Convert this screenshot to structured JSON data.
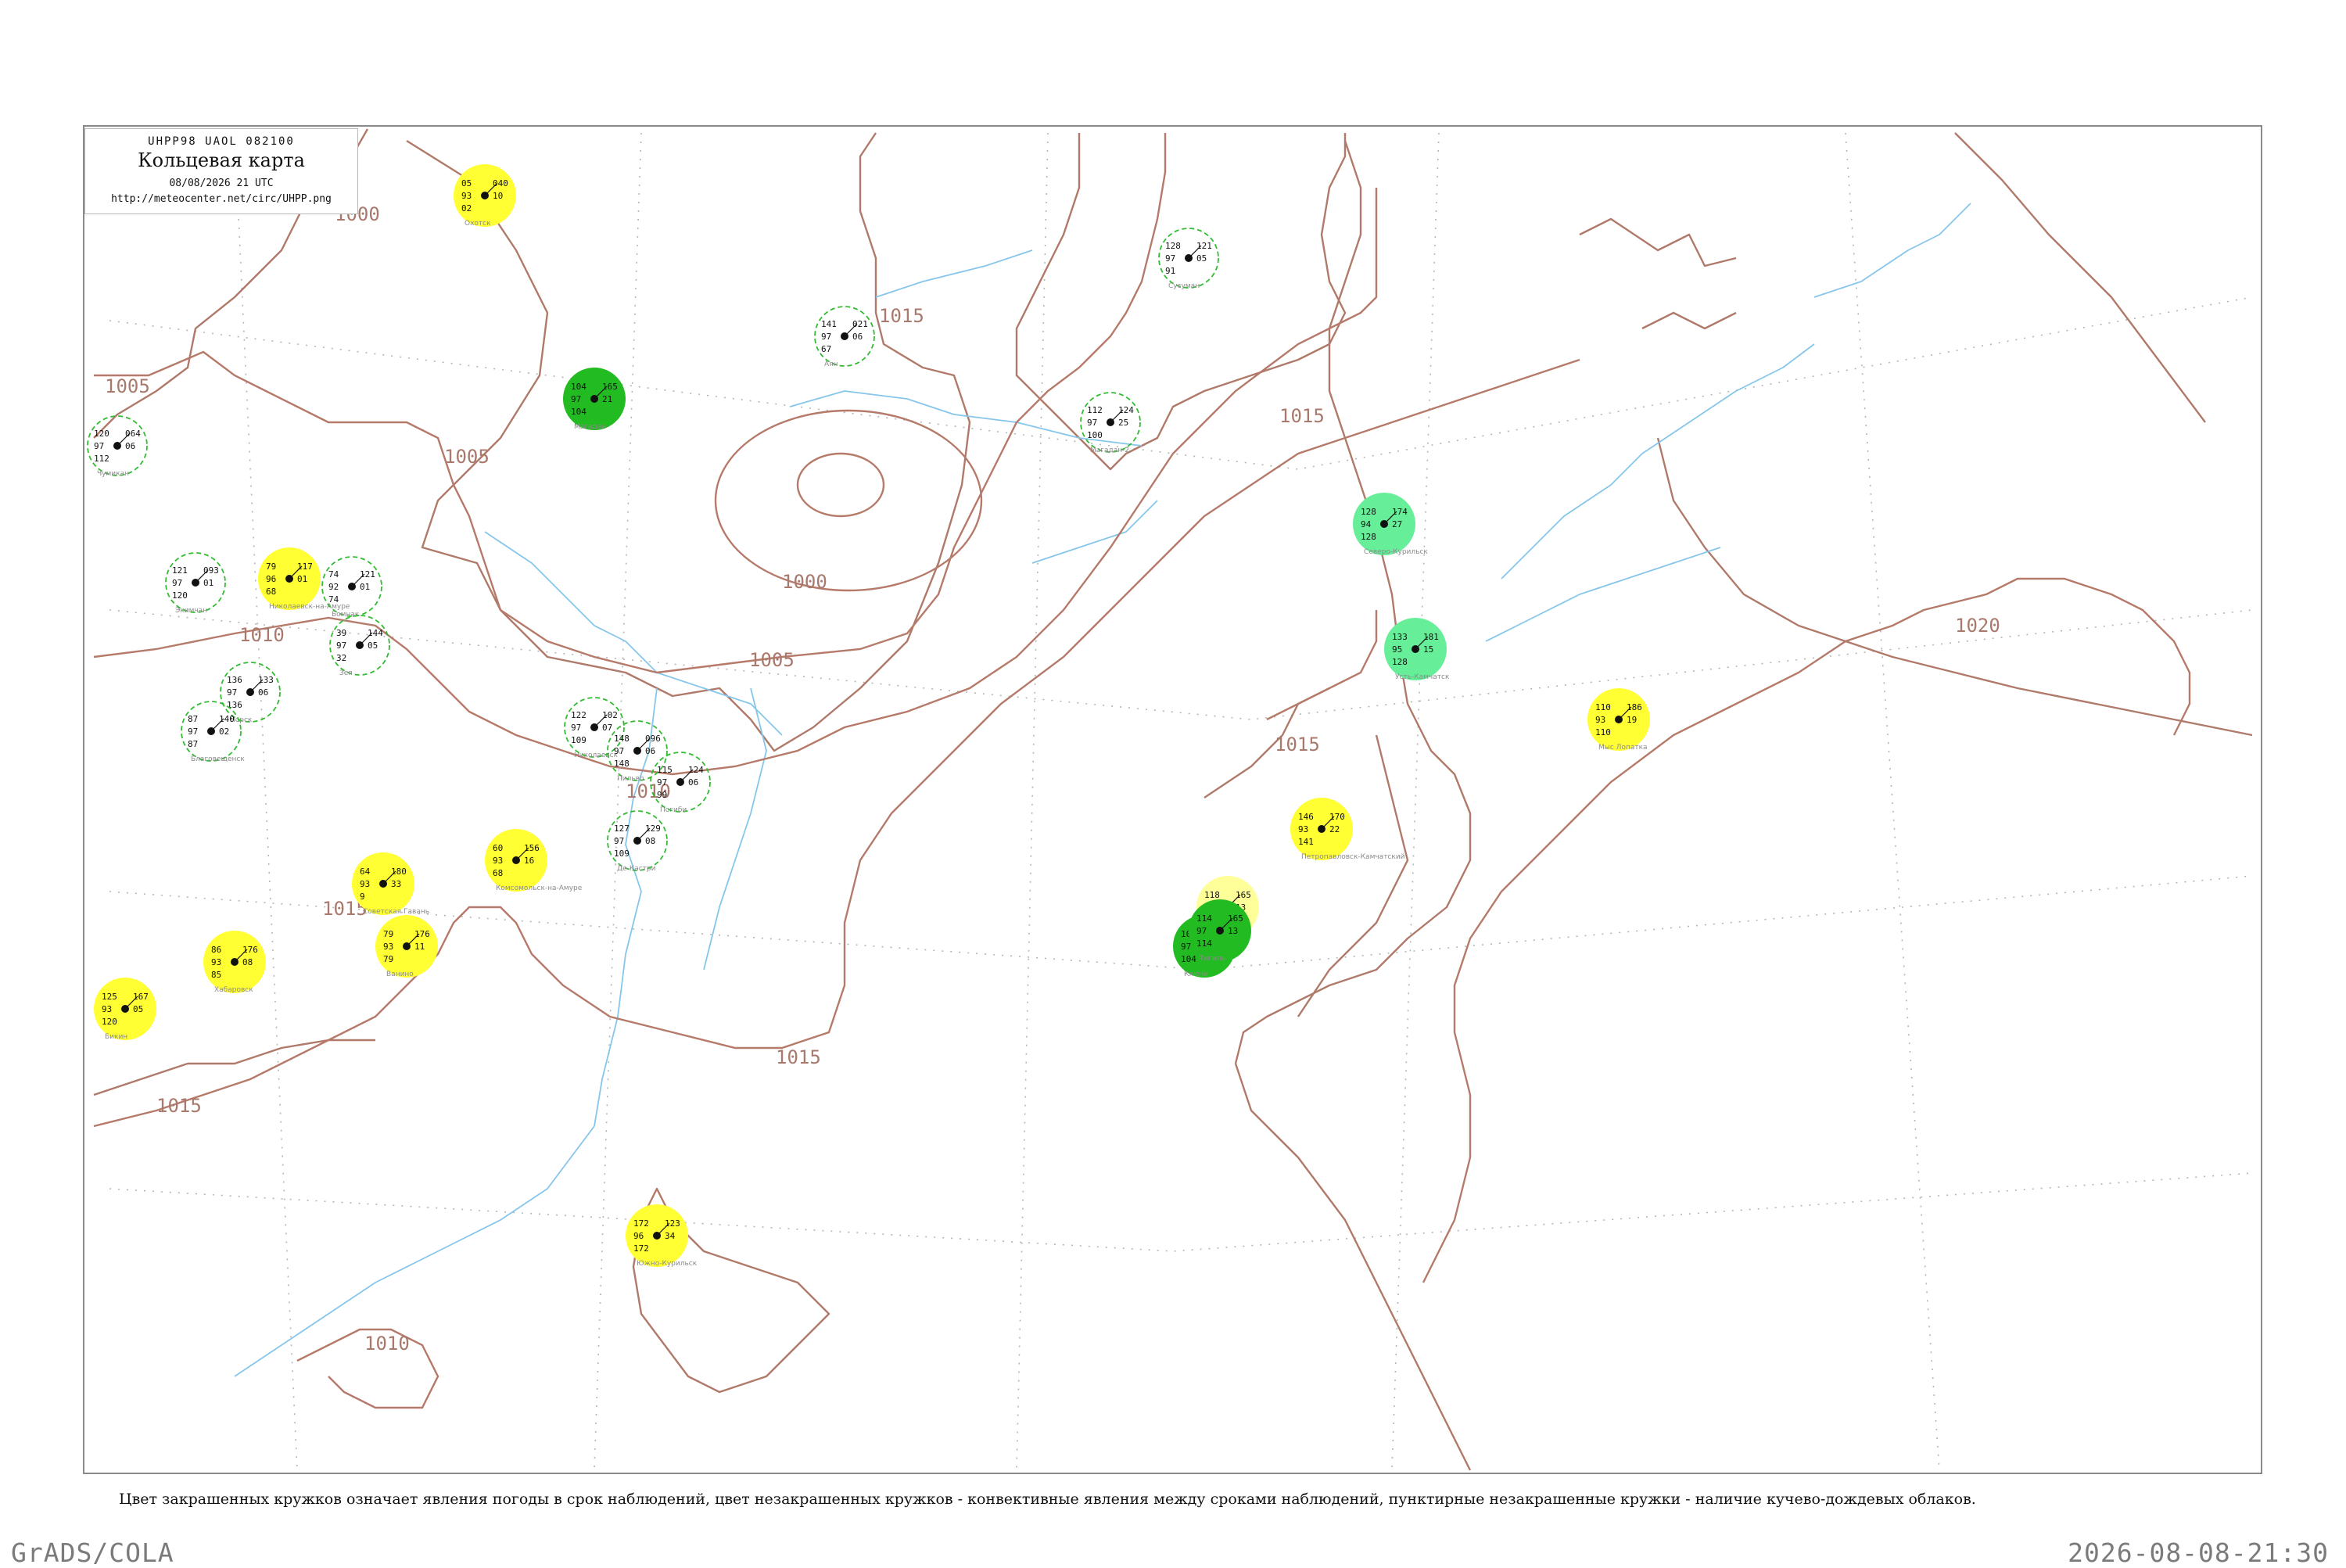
{
  "header": {
    "code": "UHPP98  UAOL  082100",
    "title": "Кольцевая карта",
    "datetime": "08/08/2026 21 UTC",
    "url": "http://meteocenter.net/circ/UHPP.png"
  },
  "legend_text": "Цвет закрашенных кружков означает явления погоды в срок наблюдений, цвет незакрашенных кружков - конвективные явления между сроками наблюдений, пунктирные незакрашенные кружки - наличие кучево-дождевых облаков.",
  "footer": {
    "left": "GrADS/COLA",
    "right": "2026-08-08-21:30"
  },
  "colors": {
    "frame": "#8a8a8a",
    "coast": "#b07a6a",
    "river": "#86c6ea",
    "isobar": "#b57a6a",
    "rain_fill": "#ffff33",
    "light_rain_fill": "#ffff99",
    "thunder_fill": "#22bb22",
    "shower_fill": "#66ee99",
    "cb_circle": "#33bb33"
  },
  "isobars": [
    {
      "value": "1000",
      "label": "1000"
    },
    {
      "value": "1005",
      "label": "1005"
    },
    {
      "value": "1010",
      "label": "1010"
    },
    {
      "value": "1015",
      "label": "1015"
    },
    {
      "value": "1020",
      "label": "1020"
    }
  ],
  "stations": [
    {
      "name": "Охотск",
      "t": "05",
      "p": "040",
      "dp": "93",
      "tr": "10",
      "extra": "02",
      "phen": "rain"
    },
    {
      "name": "Магадан",
      "t": "104",
      "p": "165",
      "dp": "97",
      "tr": "21",
      "extra": "104",
      "phen": "thunder"
    },
    {
      "name": "Николаевск-на-Амуре",
      "t": "79",
      "p": "117",
      "dp": "96",
      "tr": "01",
      "extra": "68",
      "phen": "rain"
    },
    {
      "name": "Северо-Курильск",
      "t": "128",
      "p": "174",
      "dp": "94",
      "tr": "27",
      "extra": "128",
      "phen": "shower"
    },
    {
      "name": "Усть-Камчатск",
      "t": "133",
      "p": "181",
      "dp": "95",
      "tr": "15",
      "extra": "128",
      "phen": "shower"
    },
    {
      "name": "Петропавловск-Камчатский",
      "t": "146",
      "p": "170",
      "dp": "93",
      "tr": "22",
      "extra": "141",
      "phen": "rain"
    },
    {
      "name": "Мыс Лопатка",
      "t": "110",
      "p": "186",
      "dp": "93",
      "tr": "19",
      "extra": "110",
      "phen": "rain"
    },
    {
      "name": "Южно-Курильск",
      "t": "172",
      "p": "123",
      "dp": "96",
      "tr": "34",
      "extra": "172",
      "phen": "rain"
    },
    {
      "name": "Советская Гавань",
      "t": "64",
      "p": "180",
      "dp": "93",
      "tr": "33",
      "extra": "9",
      "phen": "rain"
    },
    {
      "name": "Ванино",
      "t": "79",
      "p": "176",
      "dp": "93",
      "tr": "11",
      "extra": "79",
      "phen": "rain"
    },
    {
      "name": "Хабаровск",
      "t": "86",
      "p": "176",
      "dp": "93",
      "tr": "08",
      "extra": "85",
      "phen": "rain"
    },
    {
      "name": "Бикин",
      "t": "125",
      "p": "167",
      "dp": "93",
      "tr": "05",
      "extra": "120",
      "phen": "rain"
    },
    {
      "name": "Комсомольск-на-Амуре",
      "t": "60",
      "p": "156",
      "dp": "93",
      "tr": "16",
      "extra": "68",
      "phen": "rain"
    },
    {
      "name": "Оха",
      "t": "118",
      "p": "165",
      "dp": "95",
      "tr": "13",
      "extra": "117",
      "phen": "light_rain"
    },
    {
      "name": "Ключи",
      "t": "104",
      "p": "165",
      "dp": "97",
      "tr": "21",
      "extra": "104",
      "phen": "thunder"
    },
    {
      "name": "Тигиль",
      "t": "114",
      "p": "165",
      "dp": "97",
      "tr": "13",
      "extra": "114",
      "phen": "thunder"
    },
    {
      "name": "Аян",
      "t": "141",
      "p": "021",
      "dp": "97",
      "tr": "06",
      "extra": "67",
      "phen": "cb"
    },
    {
      "name": "Магадан-2",
      "t": "112",
      "p": "124",
      "dp": "97",
      "tr": "25",
      "extra": "100",
      "phen": "cb"
    },
    {
      "name": "Сусуман",
      "t": "128",
      "p": "121",
      "dp": "97",
      "tr": "05",
      "extra": "91",
      "phen": "cb"
    },
    {
      "name": "Чумикан",
      "t": "120",
      "p": "064",
      "dp": "97",
      "tr": "06",
      "extra": "112",
      "phen": "cb"
    },
    {
      "name": "Экимчан",
      "t": "121",
      "p": "093",
      "dp": "97",
      "tr": "01",
      "extra": "120",
      "phen": "cb"
    },
    {
      "name": "Бомнак",
      "t": "74",
      "p": "121",
      "dp": "92",
      "tr": "01",
      "extra": "74",
      "phen": "cb"
    },
    {
      "name": "Зея",
      "t": "39",
      "p": "144",
      "dp": "97",
      "tr": "05",
      "extra": "32",
      "phen": "cb"
    },
    {
      "name": "Норск",
      "t": "136",
      "p": "133",
      "dp": "97",
      "tr": "06",
      "extra": "136",
      "phen": "cb"
    },
    {
      "name": "Благовещенск",
      "t": "87",
      "p": "140",
      "dp": "97",
      "tr": "02",
      "extra": "87",
      "phen": "cb"
    },
    {
      "name": "Николаевск",
      "t": "122",
      "p": "102",
      "dp": "97",
      "tr": "07",
      "extra": "109",
      "phen": "cb"
    },
    {
      "name": "Пильво",
      "t": "148",
      "p": "096",
      "dp": "97",
      "tr": "06",
      "extra": "148",
      "phen": "cb"
    },
    {
      "name": "Погиби",
      "t": "115",
      "p": "124",
      "dp": "97",
      "tr": "06",
      "extra": "99",
      "phen": "cb"
    },
    {
      "name": "Де-Кастри",
      "t": "127",
      "p": "129",
      "dp": "97",
      "tr": "08",
      "extra": "109",
      "phen": "cb"
    }
  ]
}
